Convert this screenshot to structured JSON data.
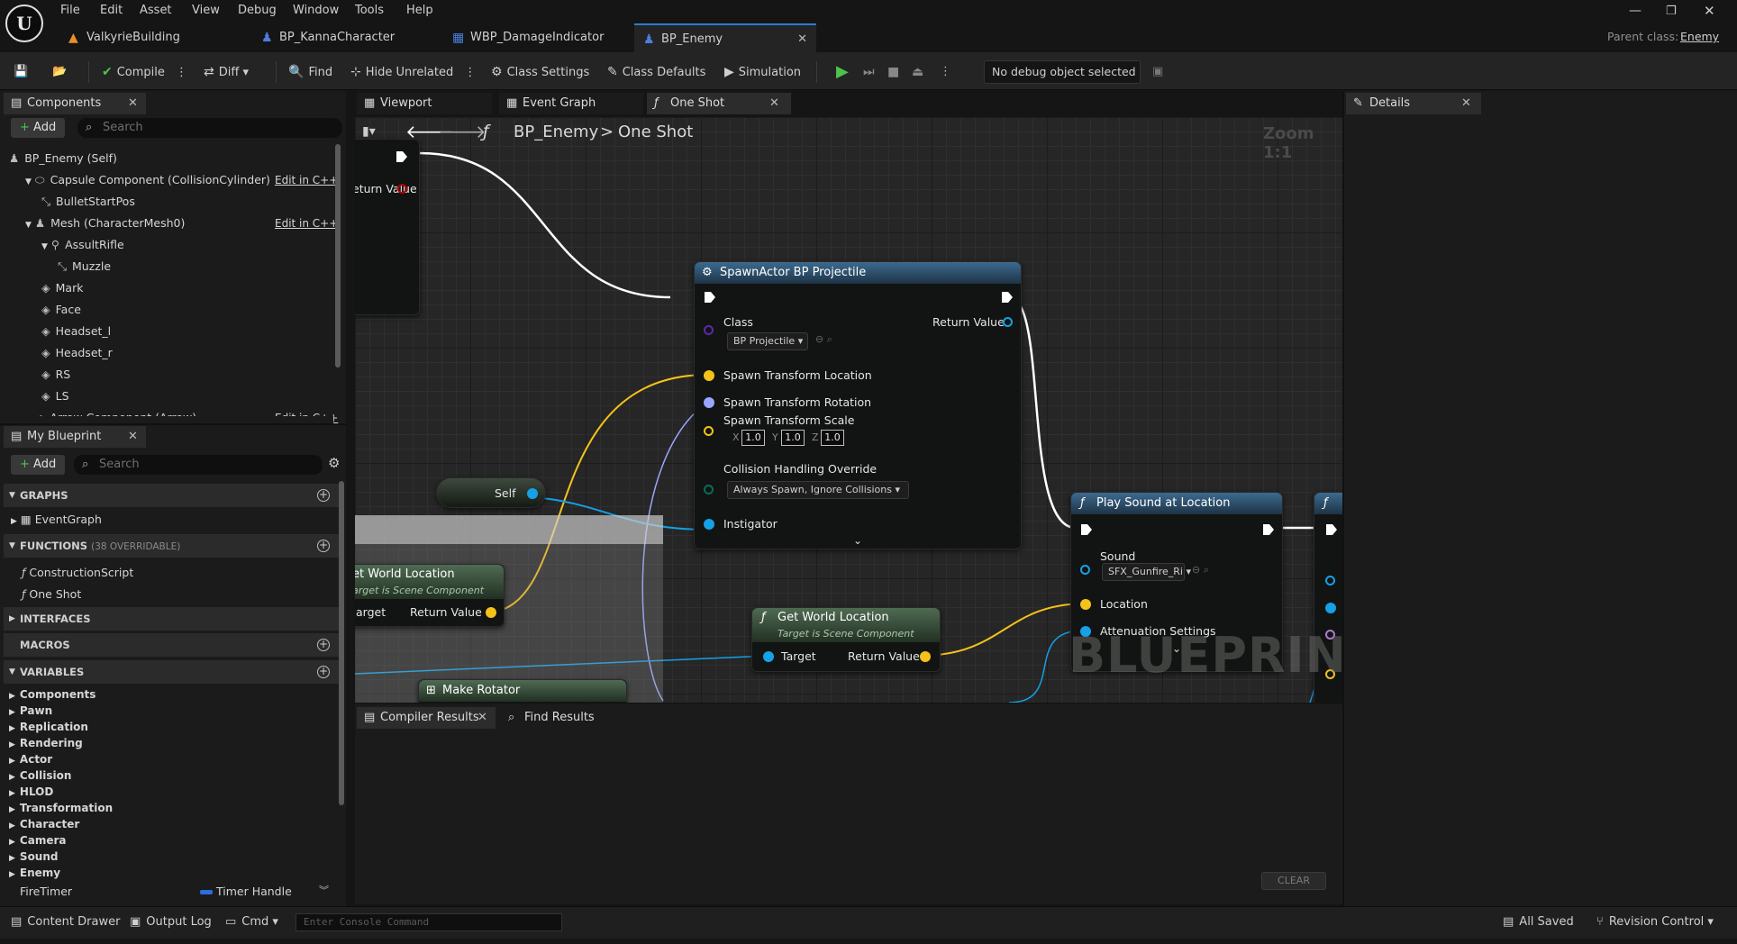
{
  "menu": [
    "File",
    "Edit",
    "Asset",
    "View",
    "Debug",
    "Window",
    "Tools",
    "Help"
  ],
  "doc_tabs": [
    {
      "label": "ValkyrieBuilding",
      "icon": "level-icon"
    },
    {
      "label": "BP_KannaCharacter",
      "icon": "character-icon"
    },
    {
      "label": "WBP_DamageIndicator",
      "icon": "widget-icon"
    },
    {
      "label": "BP_Enemy",
      "icon": "character-icon"
    }
  ],
  "parent_class": {
    "label": "Parent class:",
    "value": "Enemy"
  },
  "toolbar": {
    "compile": "Compile",
    "diff": "Diff",
    "find": "Find",
    "hide_unrelated": "Hide Unrelated",
    "class_settings": "Class Settings",
    "class_defaults": "Class Defaults",
    "simulation": "Simulation",
    "debug_object": "No debug object selected"
  },
  "components_panel": {
    "title": "Components",
    "add": "Add",
    "search_placeholder": "Search",
    "items": [
      {
        "label": "BP_Enemy (Self)",
        "indent": 0,
        "edit": ""
      },
      {
        "label": "Capsule Component (CollisionCylinder)",
        "indent": 1,
        "edit": "Edit in C++"
      },
      {
        "label": "BulletStartPos",
        "indent": 2,
        "edit": ""
      },
      {
        "label": "Mesh (CharacterMesh0)",
        "indent": 1,
        "edit": "Edit in C++"
      },
      {
        "label": "AssultRifle",
        "indent": 2,
        "edit": ""
      },
      {
        "label": "Muzzle",
        "indent": 3,
        "edit": ""
      },
      {
        "label": "Mark",
        "indent": 2,
        "edit": ""
      },
      {
        "label": "Face",
        "indent": 2,
        "edit": ""
      },
      {
        "label": "Headset_l",
        "indent": 2,
        "edit": ""
      },
      {
        "label": "Headset_r",
        "indent": 2,
        "edit": ""
      },
      {
        "label": "RS",
        "indent": 2,
        "edit": ""
      },
      {
        "label": "LS",
        "indent": 2,
        "edit": ""
      },
      {
        "label": "Arrow Component (Arrow)",
        "indent": 1,
        "edit": "Edit in C++"
      }
    ]
  },
  "my_blueprint": {
    "title": "My Blueprint",
    "add": "Add",
    "search_placeholder": "Search",
    "graphs_header": "GRAPHS",
    "graphs": [
      "EventGraph"
    ],
    "functions_header": "FUNCTIONS",
    "functions_overridable": "(38 OVERRIDABLE)",
    "functions": [
      "ConstructionScript",
      "One Shot"
    ],
    "interfaces_header": "INTERFACES",
    "macros_header": "MACROS",
    "variables_header": "VARIABLES",
    "variable_categories": [
      "Components",
      "Pawn",
      "Replication",
      "Rendering",
      "Actor",
      "Collision",
      "HLOD",
      "Transformation",
      "Character",
      "Camera",
      "Sound",
      "Enemy"
    ],
    "variable": {
      "name": "FireTimer",
      "type": "Timer Handle",
      "type_color": "#2d6cdf"
    }
  },
  "graph_tabs": {
    "viewport": "Viewport",
    "event_graph": "Event Graph",
    "one_shot": "One Shot"
  },
  "graph": {
    "breadcrumb_root": "BP_Enemy",
    "breadcrumb_sep": ">",
    "breadcrumb_leaf": "One Shot",
    "zoom": "Zoom 1:1",
    "watermark": "BLUEPRINT",
    "entry_node": {
      "return_value": "eturn Value"
    },
    "spawn_node": {
      "title": "SpawnActor BP Projectile",
      "class_label": "Class",
      "class_value": "BP Projectile",
      "return_value": "Return Value",
      "spawn_location": "Spawn Transform Location",
      "spawn_rotation": "Spawn Transform Rotation",
      "spawn_scale": "Spawn Transform Scale",
      "scale_x": "1.0",
      "scale_y": "1.0",
      "scale_z": "1.0",
      "collision_label": "Collision Handling Override",
      "collision_value": "Always Spawn, Ignore Collisions",
      "instigator": "Instigator"
    },
    "self_node": {
      "label": "Self"
    },
    "gwl_left": {
      "title": "et World Location",
      "subtitle": "arget is Scene Component",
      "target": "arget",
      "return_value": "Return Value"
    },
    "gwl": {
      "title": "Get World Location",
      "subtitle": "Target is Scene Component",
      "target": "Target",
      "return_value": "Return Value"
    },
    "make_rotator": {
      "title": "Make Rotator"
    },
    "play_sound": {
      "title": "Play Sound at Location",
      "sound_label": "Sound",
      "sound_value": "SFX_Gunfire_Ri",
      "location": "Location",
      "attenuation": "Attenuation Settings"
    },
    "colors": {
      "exec": "#ffffff",
      "vector": "#f5c21a",
      "rotator": "#9aa6ff",
      "object": "#16a0e6",
      "class": "#5a2aa8",
      "byte": "#0c6b5a"
    }
  },
  "details": {
    "title": "Details"
  },
  "compiler": {
    "tab": "Compiler Results",
    "find_tab": "Find Results",
    "clear": "CLEAR"
  },
  "bottom": {
    "content_drawer": "Content Drawer",
    "output_log": "Output Log",
    "cmd": "Cmd",
    "console_placeholder": "Enter Console Command",
    "all_saved": "All Saved",
    "revision_control": "Revision Control"
  }
}
